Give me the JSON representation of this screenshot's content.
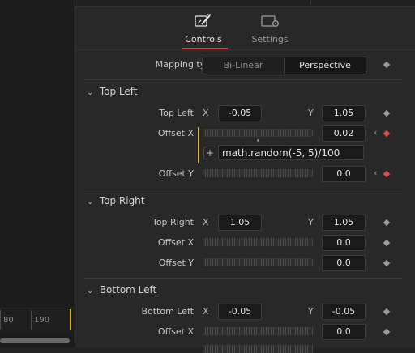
{
  "timeline": {
    "ticks": [
      "80",
      "190"
    ]
  },
  "tabs": [
    {
      "label": "Controls",
      "icon": "controls-brush-icon"
    },
    {
      "label": "Settings",
      "icon": "settings-gear-icon"
    }
  ],
  "mapping": {
    "label": "Mapping type",
    "options": [
      "Bi-Linear",
      "Perspective"
    ],
    "selected": "Perspective"
  },
  "sections": {
    "top_left": {
      "title": "Top Left",
      "point_label": "Top Left",
      "x_label": "X",
      "x_value": "-0.05",
      "y_label": "Y",
      "y_value": "1.05",
      "offset_x_label": "Offset X",
      "offset_x_value": "0.02",
      "expression": "math.random(-5, 5)/100",
      "offset_y_label": "Offset Y",
      "offset_y_value": "0.0"
    },
    "top_right": {
      "title": "Top Right",
      "point_label": "Top Right",
      "x_label": "X",
      "x_value": "1.05",
      "y_label": "Y",
      "y_value": "1.05",
      "offset_x_label": "Offset X",
      "offset_x_value": "0.0",
      "offset_y_label": "Offset Y",
      "offset_y_value": "0.0"
    },
    "bottom_left": {
      "title": "Bottom Left",
      "point_label": "Bottom Left",
      "x_label": "X",
      "x_value": "-0.05",
      "y_label": "Y",
      "y_value": "-0.05",
      "offset_x_label": "Offset X",
      "offset_x_value": "0.0"
    }
  },
  "colors": {
    "accent": "#d2473e",
    "keyframe_active": "#e14b4b",
    "expression_bracket": "#d1b346",
    "playhead": "#e5b400"
  }
}
